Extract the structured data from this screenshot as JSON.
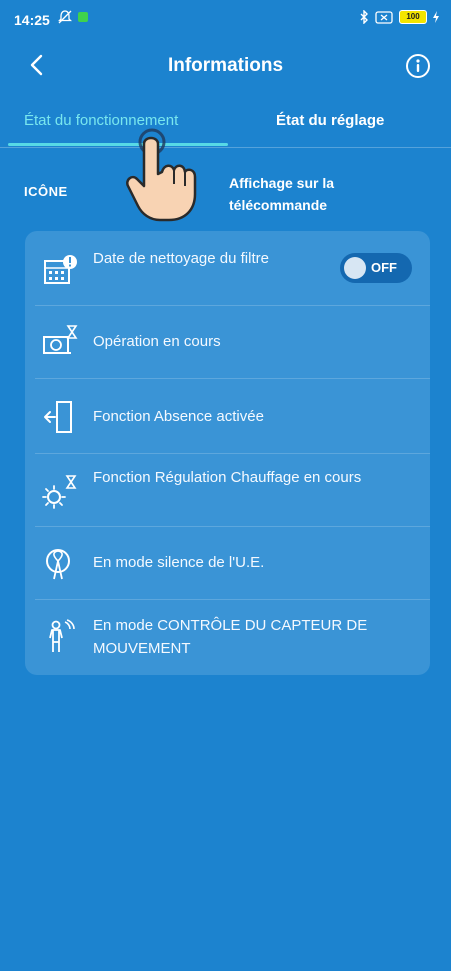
{
  "status_bar": {
    "time": "14:25",
    "battery": "100"
  },
  "header": {
    "title": "Informations",
    "back_icon": "chevron-left-icon",
    "info_icon": "info-circle-icon"
  },
  "tabs": [
    {
      "label": "État du fonctionnement",
      "active": true
    },
    {
      "label": "État du réglage",
      "active": false
    }
  ],
  "columns": {
    "icon_header": "ICÔNE",
    "display_header": "Affichage sur la télécommande"
  },
  "rows": [
    {
      "icon": "filter-calendar-alert-icon",
      "label": "Date de nettoyage du filtre",
      "toggle": {
        "state": "OFF"
      }
    },
    {
      "icon": "unit-hourglass-icon",
      "label": "Opération en cours"
    },
    {
      "icon": "door-exit-icon",
      "label": "Fonction Absence activée"
    },
    {
      "icon": "sun-hourglass-icon",
      "label": "Fonction Régulation Chauffage en cours"
    },
    {
      "icon": "silent-fan-icon",
      "label": "En mode silence de l'U.E."
    },
    {
      "icon": "motion-sensor-person-icon",
      "label": "En mode CONTRÔLE DU CAPTEUR DE MOUVEMENT"
    }
  ],
  "colors": {
    "background": "#1c83cf",
    "card": "#3a94d6",
    "active_tab": "#78e6ee",
    "toggle_track": "#1468b0"
  }
}
